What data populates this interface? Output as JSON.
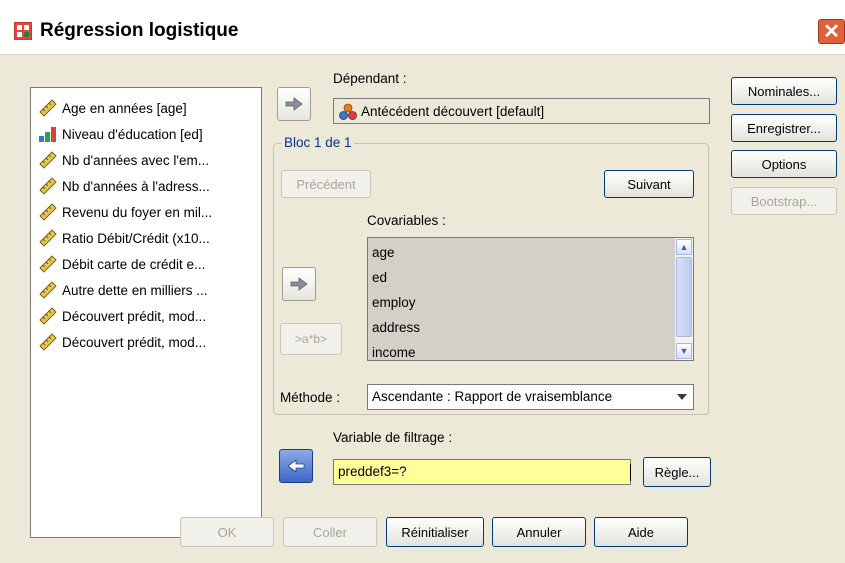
{
  "window": {
    "title": "Régression logistique",
    "close_label": "✕"
  },
  "variables": [
    {
      "label": "Age en années [age]",
      "icon": "scale-ruler-icon"
    },
    {
      "label": "Niveau d'éducation [ed]",
      "icon": "ordinal-bars-icon"
    },
    {
      "label": "Nb d'années avec l'em...",
      "icon": "scale-ruler-icon"
    },
    {
      "label": "Nb d'années à l'adress...",
      "icon": "scale-ruler-icon"
    },
    {
      "label": "Revenu du foyer en mil...",
      "icon": "scale-ruler-icon"
    },
    {
      "label": "Ratio Débit/Crédit  (x10...",
      "icon": "scale-ruler-icon"
    },
    {
      "label": "Débit carte de crédit e...",
      "icon": "scale-ruler-icon"
    },
    {
      "label": "Autre dette en milliers ...",
      "icon": "scale-ruler-icon"
    },
    {
      "label": "Découvert prédit, mod...",
      "icon": "scale-ruler-icon"
    },
    {
      "label": "Découvert prédit, mod...",
      "icon": "scale-ruler-icon"
    }
  ],
  "dependent": {
    "label": "Dépendant :",
    "value": "Antécédent découvert [default]"
  },
  "bloc": {
    "legend": "Bloc 1 de 1",
    "previous_label": "Précédent",
    "next_label": "Suivant"
  },
  "covariates": {
    "label": "Covariables :",
    "items": [
      "age",
      "ed",
      "employ",
      "address",
      "income"
    ]
  },
  "interaction_button_label": ">a*b>",
  "method": {
    "label": "Méthode :",
    "value": "Ascendante : Rapport de vraisemblance"
  },
  "filter": {
    "label": "Variable de filtrage :",
    "value": "preddef3=?",
    "rule_label": "Règle..."
  },
  "side_buttons": {
    "nominal": "Nominales...",
    "save": "Enregistrer...",
    "options": "Options",
    "bootstrap": "Bootstrap..."
  },
  "bottom_buttons": {
    "ok": "OK",
    "paste": "Coller",
    "reset": "Réinitialiser",
    "cancel": "Annuler",
    "help": "Aide"
  },
  "colors": {
    "dialog_bg": "#ece9d8",
    "filter_bg": "#ffff99",
    "close_red": "#e0603c",
    "accent_blue": "#003c74"
  }
}
